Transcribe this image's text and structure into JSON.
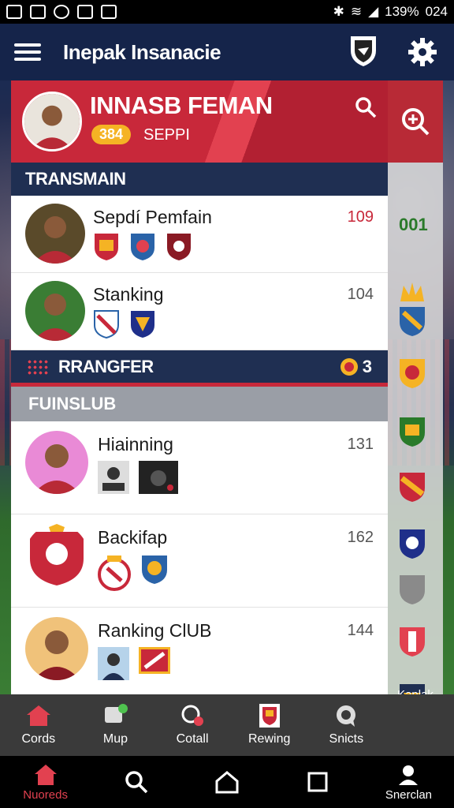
{
  "status": {
    "battery": "139%",
    "time": "024"
  },
  "header": {
    "title": "Inepak Insanacie",
    "shield_icon": "shield-icon",
    "settings_icon": "gear-icon"
  },
  "profile": {
    "name": "INNASB FEMAN",
    "score": "384",
    "subtitle": "SEPPI"
  },
  "section1": {
    "title": "TRANSMAIN"
  },
  "rows1": [
    {
      "name": "Sepdí Pemfain",
      "value": "109",
      "value_color": "#c8283a"
    },
    {
      "name": "Stanking",
      "value": "104",
      "value_color": "#555555"
    }
  ],
  "band": {
    "label": "RRANGFER",
    "count": "3"
  },
  "section2": {
    "title": "FUINSLUB"
  },
  "rows2": [
    {
      "name": "Hiainning",
      "value": "131"
    },
    {
      "name": "Backifap",
      "value": "162"
    },
    {
      "name": "Ranking ClUB",
      "value": "144"
    }
  ],
  "rail": {
    "value": "001",
    "more_label": "Kaplak Vemater"
  },
  "toolbar": [
    {
      "label": "Cords",
      "icon": "home-icon"
    },
    {
      "label": "Mup",
      "icon": "chat-icon"
    },
    {
      "label": "Cotall",
      "icon": "record-icon"
    },
    {
      "label": "Rewing",
      "icon": "crest-icon"
    },
    {
      "label": "Snicts",
      "icon": "bubble-icon"
    }
  ],
  "navbar": [
    {
      "label": "Nuoreds",
      "icon": "home-icon"
    },
    {
      "label": "",
      "icon": "search-icon"
    },
    {
      "label": "",
      "icon": "house-outline-icon"
    },
    {
      "label": "",
      "icon": "square-icon"
    },
    {
      "label": "Snerclan",
      "icon": "person-icon"
    }
  ],
  "colors": {
    "accent": "#c8283a",
    "navy": "#1f2f52",
    "gold": "#f5b324"
  }
}
